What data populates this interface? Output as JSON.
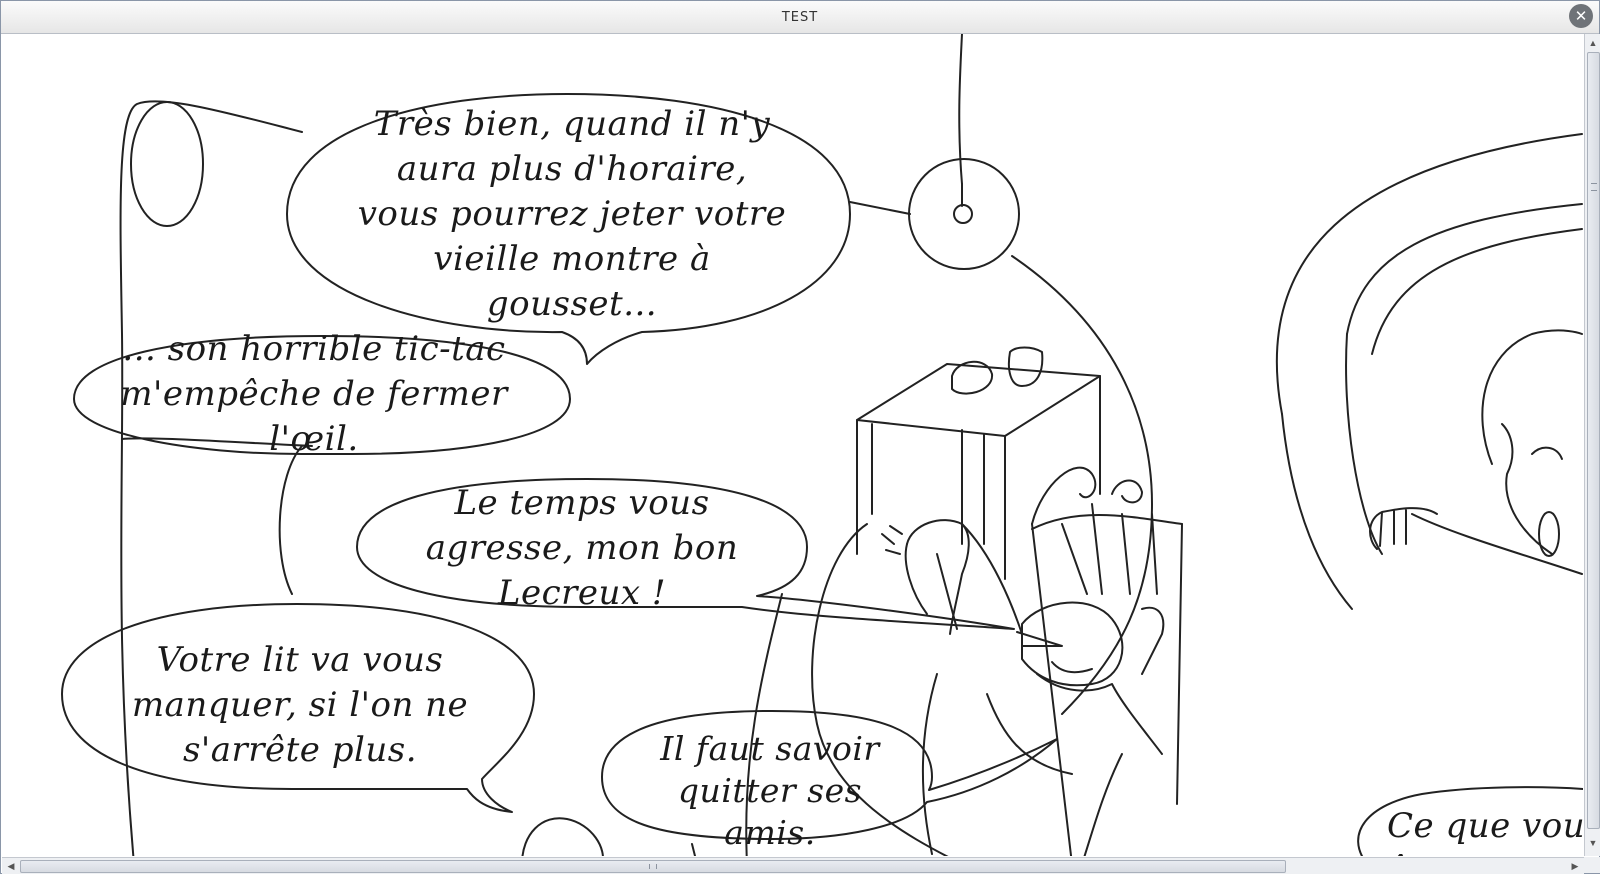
{
  "window": {
    "title": "TEST",
    "close_icon": "✕"
  },
  "scrollbars": {
    "up_arrow": "▲",
    "down_arrow": "▼",
    "left_arrow": "◀",
    "right_arrow": "▶"
  },
  "comic": {
    "bubbles": [
      {
        "text": "Très bien, quand il n'y aura plus d'horaire, vous pourrez jeter votre vieille montre à gousset..."
      },
      {
        "text": "... son horrible tic-tac m'empêche de fermer l'œil."
      },
      {
        "text": "Le temps vous agresse, mon bon Lecreux !"
      },
      {
        "text": "Votre lit va vous manquer, si l'on ne s'arrête plus."
      },
      {
        "text": "Il faut savoir quitter ses amis."
      },
      {
        "text": "Ce que vou être sur"
      }
    ]
  }
}
